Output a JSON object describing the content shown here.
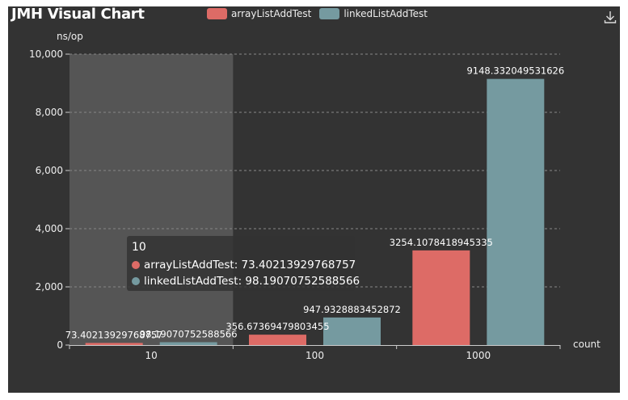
{
  "header": {
    "title": "JMH Visual Chart",
    "download_icon": "download-icon"
  },
  "colors": {
    "background": "#333333",
    "arrayListAddTest": "#dd6b66",
    "linkedListAddTest": "#759aa0",
    "pointer_band": "#555555",
    "grid": "#888888",
    "text": "#eeeeee"
  },
  "chart_data": {
    "type": "bar",
    "title": "JMH Visual Chart",
    "xlabel": "count",
    "ylabel": "ns/op",
    "categories": [
      "10",
      "100",
      "1000"
    ],
    "ylim": [
      0,
      10000
    ],
    "yticks": [
      "0",
      "2,000",
      "4,000",
      "6,000",
      "8,000",
      "10,000"
    ],
    "grid": true,
    "legend_position": "top-center",
    "hover_category": "10",
    "series": [
      {
        "name": "arrayListAddTest",
        "values": [
          73.40213929768757,
          356.67369479803455,
          3254.1078418945335
        ],
        "labels": [
          "73.40213929768757",
          "356.67369479803455",
          "3254.1078418945335"
        ]
      },
      {
        "name": "linkedListAddTest",
        "values": [
          98.19070752588566,
          947.9328883452872,
          9148.332049531626
        ],
        "labels": [
          "98.19070752588566",
          "947.9328883452872",
          "9148.332049531626"
        ]
      }
    ]
  },
  "tooltip": {
    "header": "10",
    "rows": [
      {
        "label": "arrayListAddTest: 73.40213929768757"
      },
      {
        "label": "linkedListAddTest: 98.19070752588566"
      }
    ]
  }
}
